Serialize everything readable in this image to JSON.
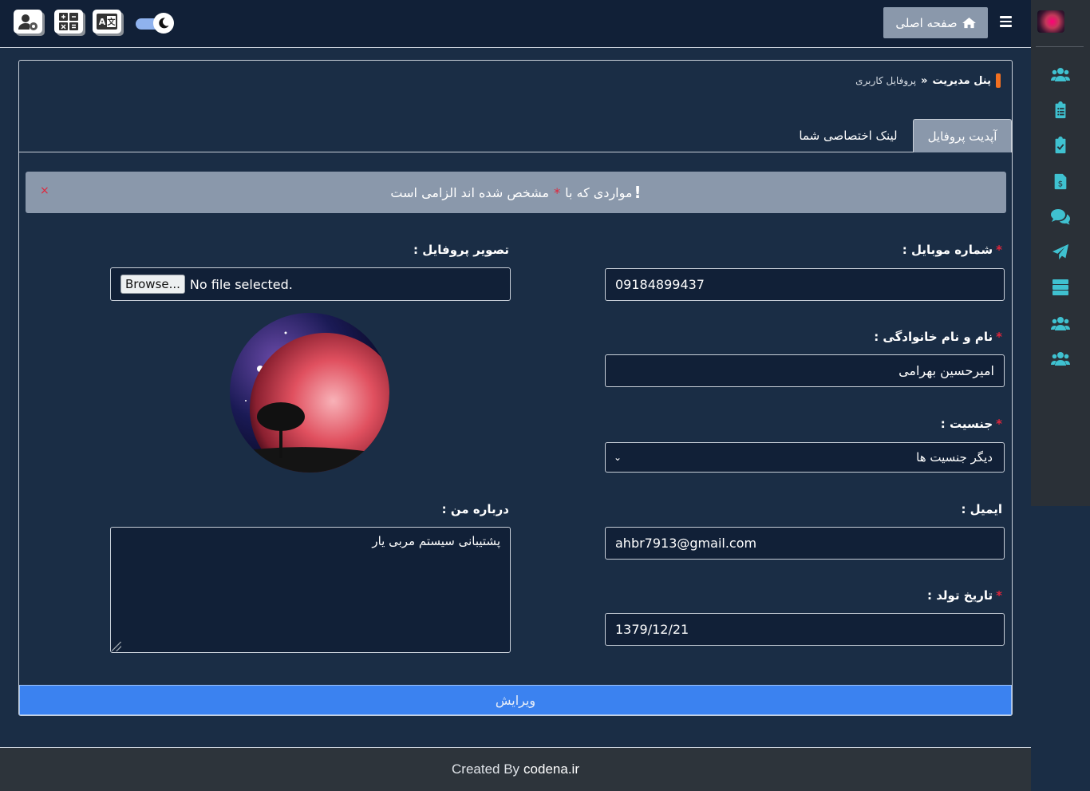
{
  "header": {
    "home_label": "صفحه اصلی",
    "tool_icons": [
      "user-settings-icon",
      "calculator-icon",
      "translate-icon"
    ],
    "theme_toggle": "dark-mode-toggle"
  },
  "sidebar": {
    "items": [
      {
        "icon": "users-icon"
      },
      {
        "icon": "clipboard-list-icon"
      },
      {
        "icon": "clipboard-check-icon"
      },
      {
        "icon": "invoice-dollar-icon"
      },
      {
        "icon": "comments-icon"
      },
      {
        "icon": "paper-plane-icon"
      },
      {
        "icon": "server-icon"
      },
      {
        "icon": "users-icon"
      },
      {
        "icon": "users-icon"
      }
    ],
    "accent_color": "#3fc1d0"
  },
  "breadcrumb": {
    "main": "پنل مدیریت",
    "sub": "پروفایل کاربری"
  },
  "tabs": [
    {
      "label": "آپدیت پروفایل",
      "active": true
    },
    {
      "label": "لینک اختصاصی شما",
      "active": false
    }
  ],
  "alert": {
    "text_before": "مواردی که با",
    "required_mark": "*",
    "text_after": "مشخص شده اند الزامی است",
    "close": "×"
  },
  "form": {
    "mobile": {
      "label": "شماره موبایل :",
      "value": "09184899437",
      "required": true
    },
    "fullname": {
      "label": "نام و نام خانوادگی :",
      "value": "امیرحسین بهرامی",
      "required": true
    },
    "gender": {
      "label": "جنسیت :",
      "value": "دیگر جنسیت ها",
      "required": true
    },
    "email": {
      "label": "ایمیل :",
      "value": "ahbr7913@gmail.com",
      "required": false
    },
    "birthdate": {
      "label": "تاریخ تولد :",
      "value": "1379/12/21",
      "required": true
    },
    "profile_image": {
      "label": "تصویر پروفایل :",
      "browse": "Browse...",
      "status": "No file selected."
    },
    "about": {
      "label": "درباره من :",
      "value": "پشتیبانی سیستم مربی یار"
    },
    "submit": "ویرایش"
  },
  "footer": {
    "prefix": "Created By",
    "brand": "codena.ir"
  },
  "colors": {
    "background": "#1a2d45",
    "topbar": "#112037",
    "accent_orange": "#f37021",
    "required_red": "#e0263b",
    "primary_button": "#3b82f0"
  }
}
